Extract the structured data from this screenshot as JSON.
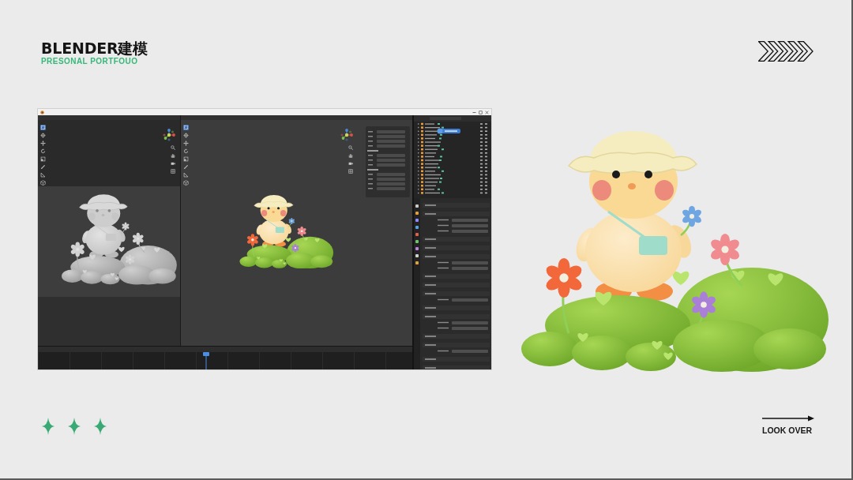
{
  "header": {
    "title": "BLENDER建模",
    "subtitle": "PRESONAL PORTFOUO"
  },
  "blender_window": {
    "viewports": [
      {
        "tools": [
          {
            "selected": true
          },
          {
            "selected": false
          },
          {
            "selected": false
          },
          {
            "selected": false
          },
          {
            "selected": false
          },
          {
            "selected": false
          },
          {
            "selected": false
          },
          {
            "selected": false
          }
        ]
      },
      {
        "tools": [
          {
            "selected": true
          },
          {
            "selected": false
          },
          {
            "selected": false
          },
          {
            "selected": false
          },
          {
            "selected": false
          },
          {
            "selected": false
          },
          {
            "selected": false
          },
          {
            "selected": false
          }
        ]
      }
    ],
    "timeline": {
      "level": 0.45
    }
  },
  "footer": {
    "label": "LOOK OVER"
  }
}
